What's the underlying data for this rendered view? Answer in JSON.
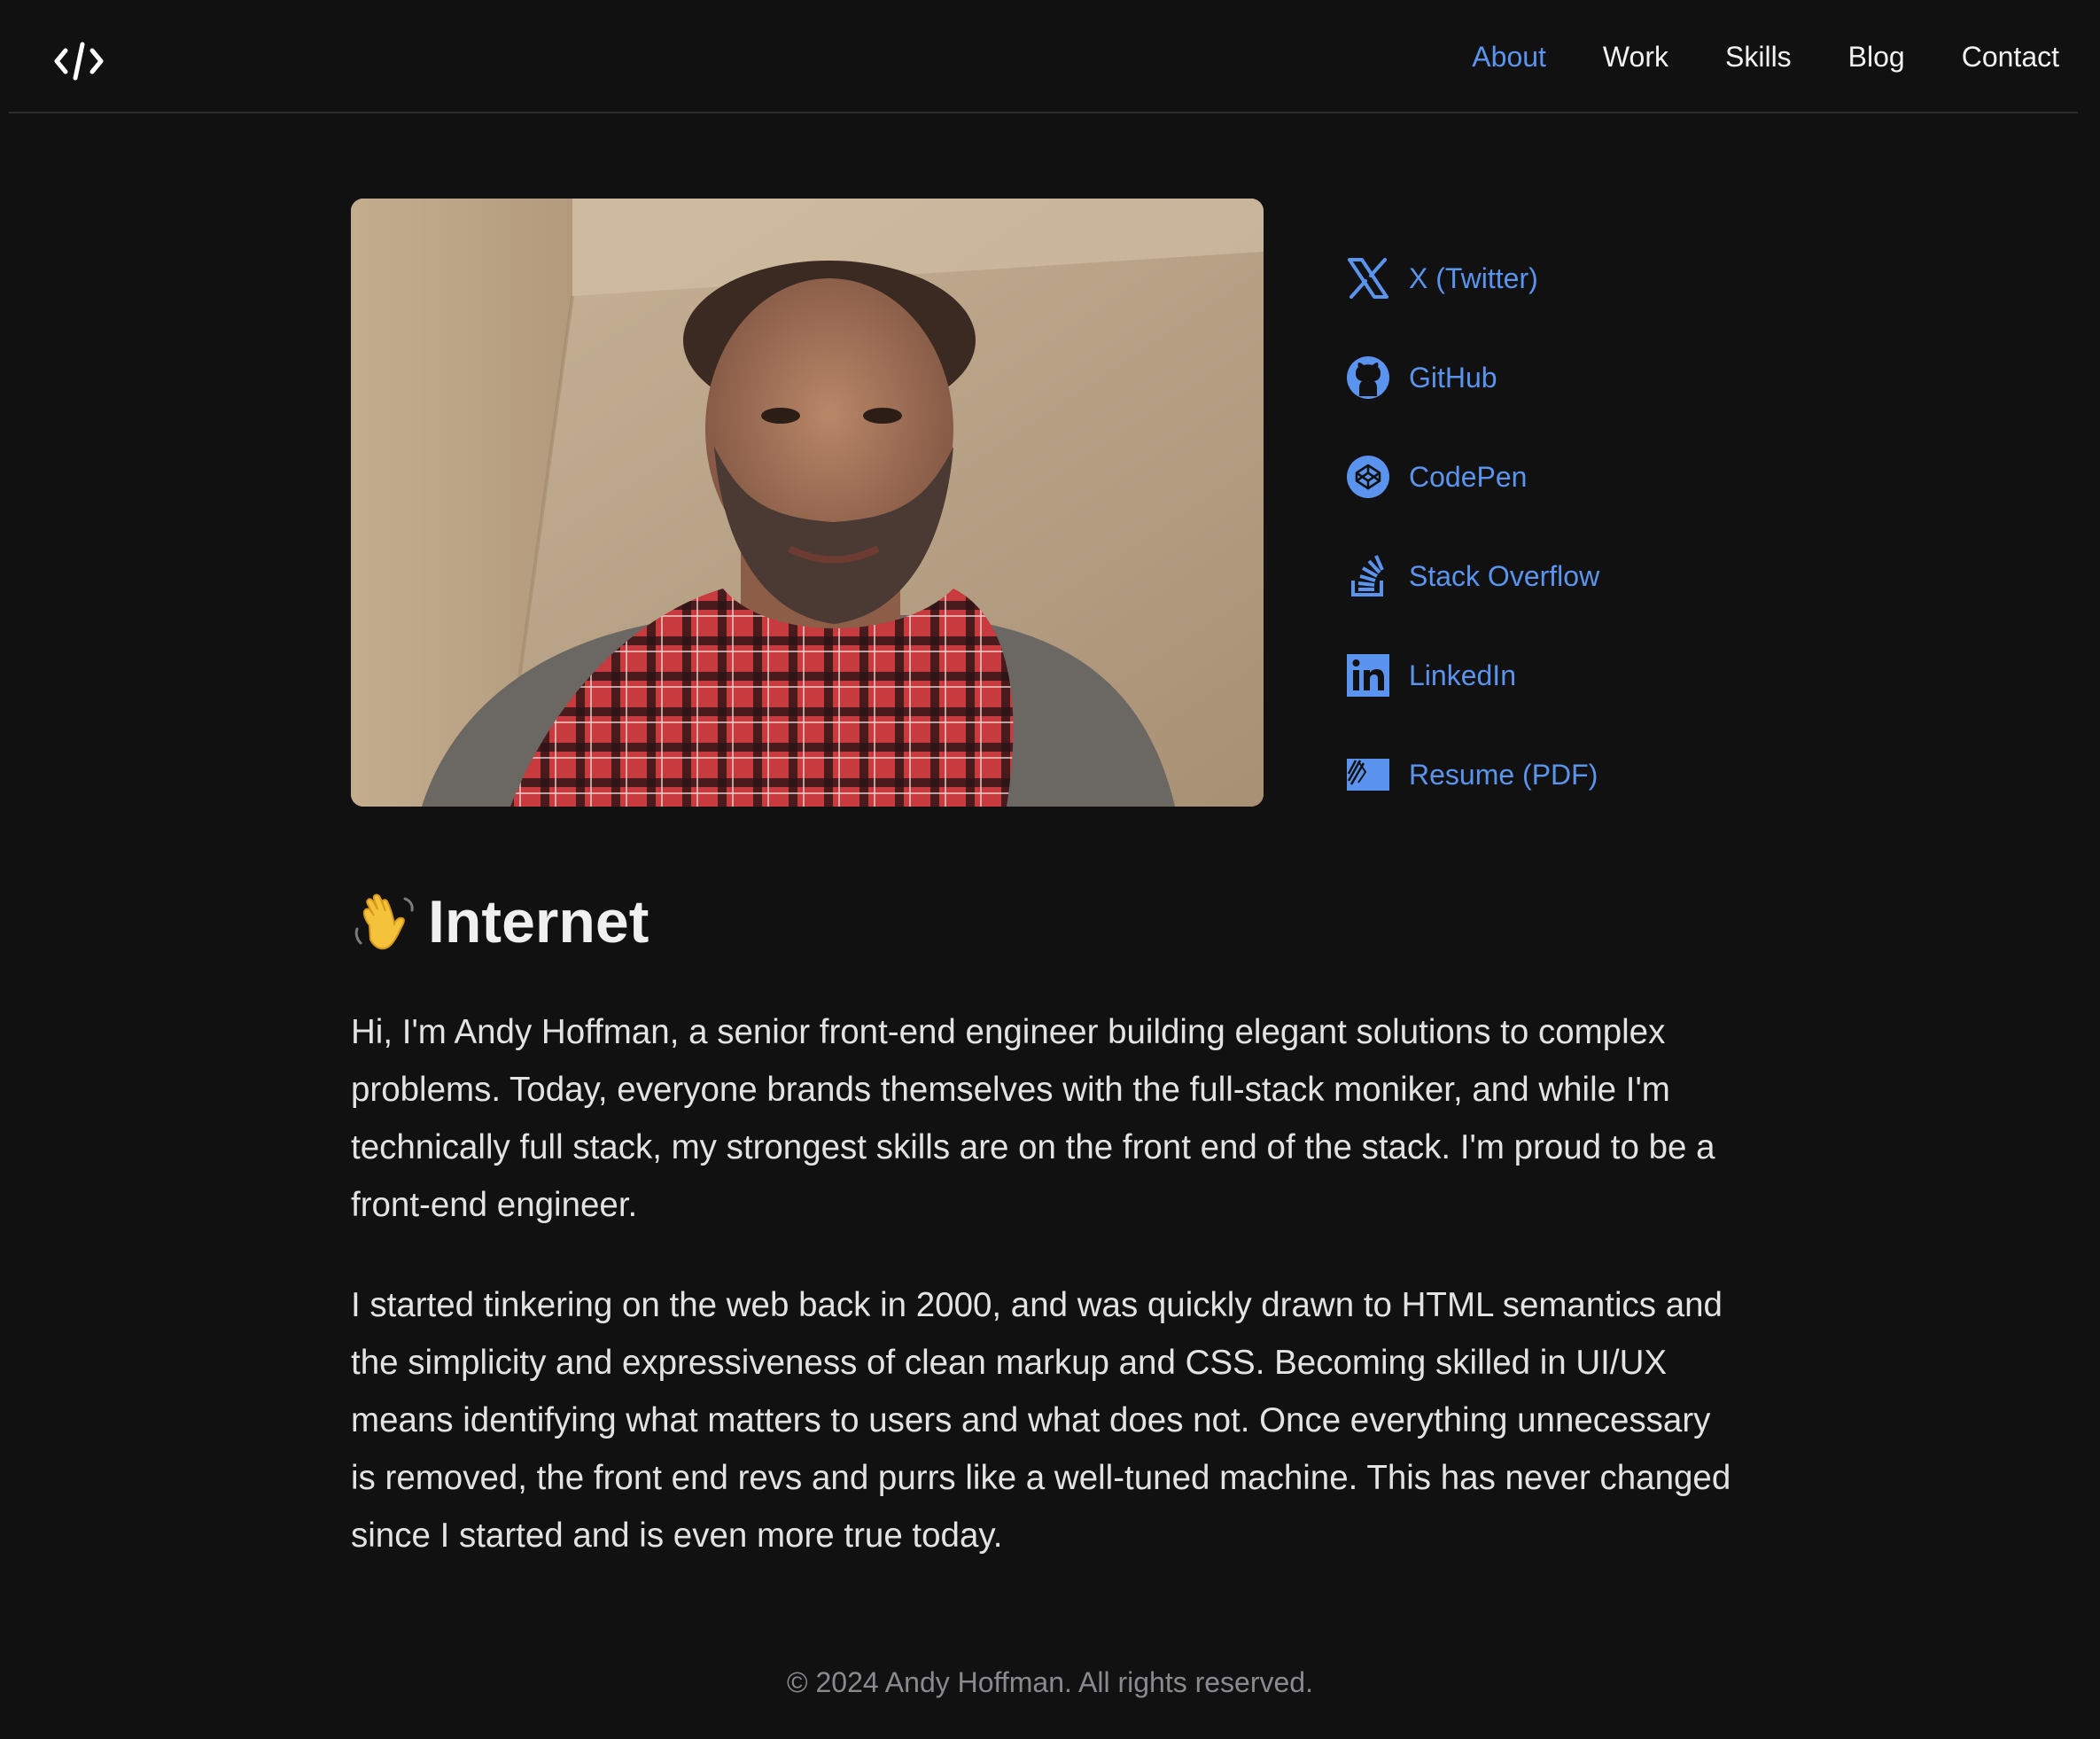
{
  "nav": {
    "logo_label": "</>",
    "items": [
      {
        "label": "About",
        "active": true
      },
      {
        "label": "Work",
        "active": false
      },
      {
        "label": "Skills",
        "active": false
      },
      {
        "label": "Blog",
        "active": false
      },
      {
        "label": "Contact",
        "active": false
      }
    ]
  },
  "socials": [
    {
      "label": "X (Twitter)",
      "icon": "x-twitter-icon"
    },
    {
      "label": "GitHub",
      "icon": "github-icon"
    },
    {
      "label": "CodePen",
      "icon": "codepen-icon"
    },
    {
      "label": "Stack Overflow",
      "icon": "stack-overflow-icon"
    },
    {
      "label": "LinkedIn",
      "icon": "linkedin-icon"
    },
    {
      "label": "Resume (PDF)",
      "icon": "resume-icon"
    }
  ],
  "hero": {
    "emoji": "👋",
    "title": "Internet"
  },
  "body": {
    "paragraph1": "Hi, I'm Andy Hoffman, a senior front-end engineer building elegant solutions to complex problems. Today, everyone brands themselves with the full-stack moniker, and while I'm technically full stack, my strongest skills are on the front end of the stack. I'm proud to be a front-end engineer.",
    "paragraph2": "I started tinkering on the web back in 2000, and was quickly drawn to HTML semantics and the simplicity and expressiveness of clean markup and CSS. Becoming skilled in UI/UX means identifying what matters to users and what does not. Once everything unnecessary is removed, the front end revs and purrs like a well-tuned machine. This has never changed since I started and is even more true today."
  },
  "footer": {
    "copyright": "© 2024 Andy Hoffman. All rights reserved."
  },
  "colors": {
    "background": "#111112",
    "accent": "#5b94ee",
    "text": "#e3e3e3",
    "muted": "#8a8a8e"
  }
}
